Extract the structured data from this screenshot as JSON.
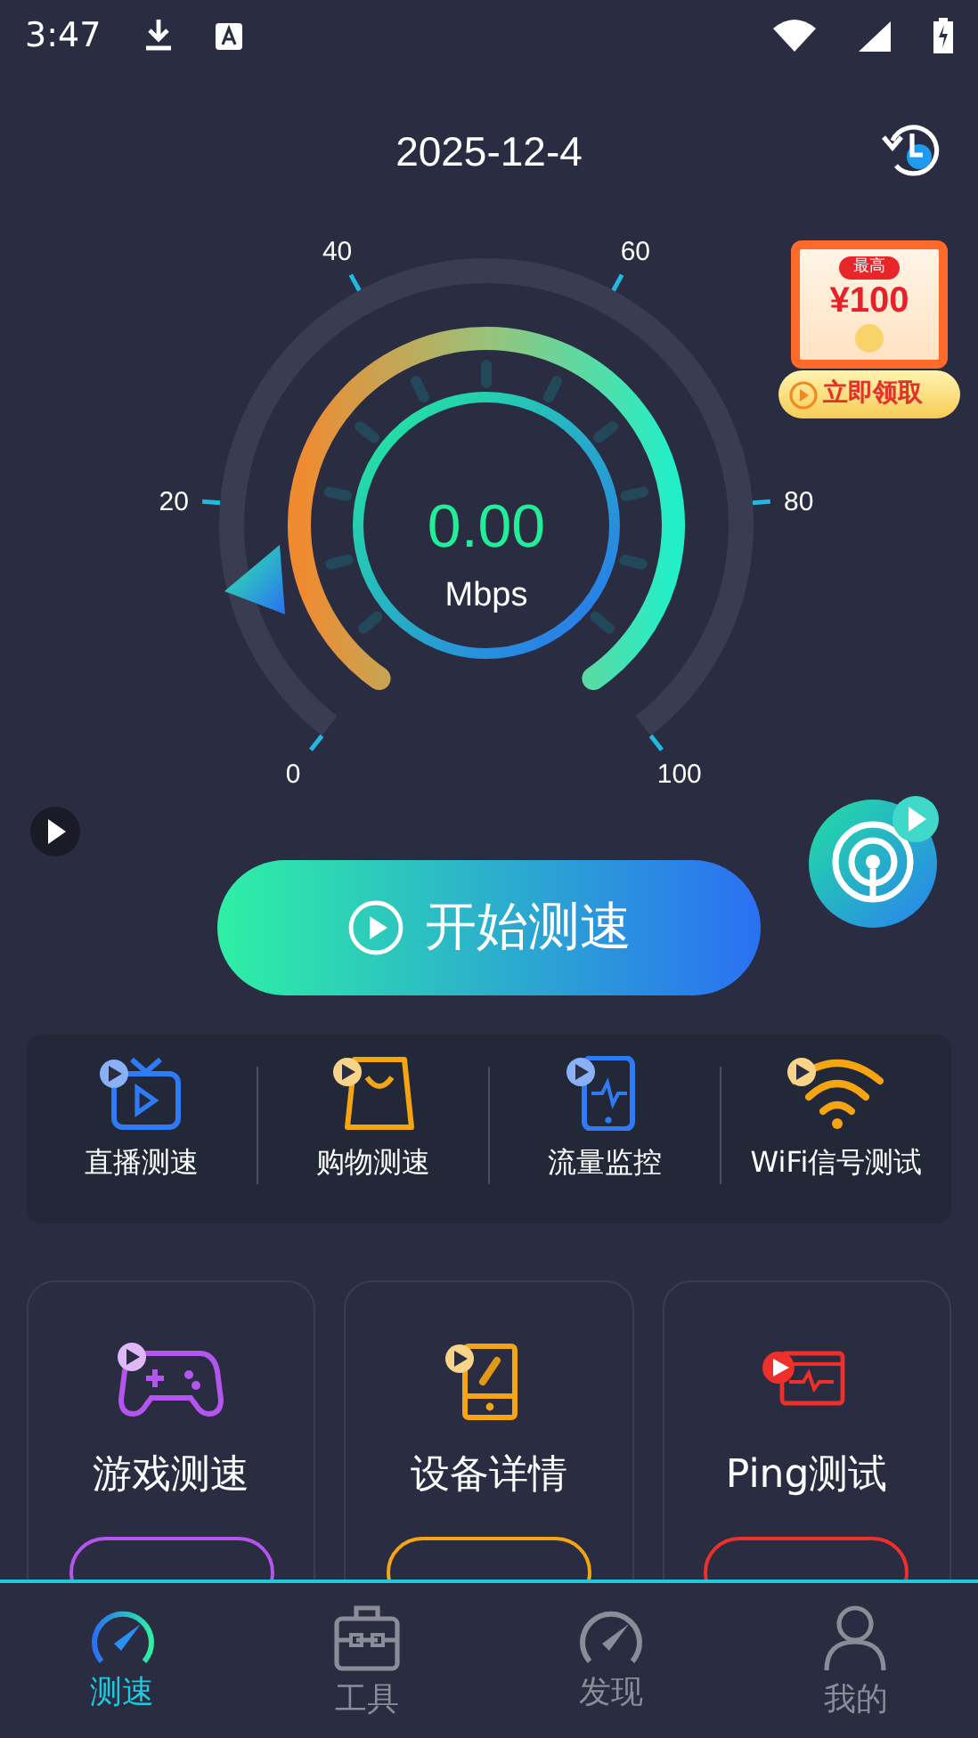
{
  "status_bar": {
    "time": "3:47"
  },
  "header": {
    "date": "2025-12-4"
  },
  "promo": {
    "top": "最高",
    "amount": "¥100",
    "action": "立即领取"
  },
  "gauge": {
    "ticks": [
      "0",
      "20",
      "40",
      "60",
      "80",
      "100"
    ],
    "reading": "0.00",
    "unit": "Mbps"
  },
  "start_button": {
    "label": "开始测速"
  },
  "quick_tools": [
    {
      "label": "直播测速",
      "kind": "tv"
    },
    {
      "label": "购物测速",
      "kind": "bag"
    },
    {
      "label": "流量监控",
      "kind": "phone"
    },
    {
      "label": "WiFi信号测试",
      "kind": "wifi"
    }
  ],
  "cards": [
    {
      "title": "游戏测速",
      "kind": "gamepad",
      "color": "#b455ee"
    },
    {
      "title": "设备详情",
      "kind": "device",
      "color": "#f5a511"
    },
    {
      "title": "Ping测试",
      "kind": "ping",
      "color": "#ee2f2a"
    }
  ],
  "tabs": [
    {
      "label": "测速",
      "kind": "speed",
      "selected": true
    },
    {
      "label": "工具",
      "kind": "toolbox",
      "selected": false
    },
    {
      "label": "发现",
      "kind": "speed",
      "selected": false
    },
    {
      "label": "我的",
      "kind": "person",
      "selected": false
    }
  ]
}
